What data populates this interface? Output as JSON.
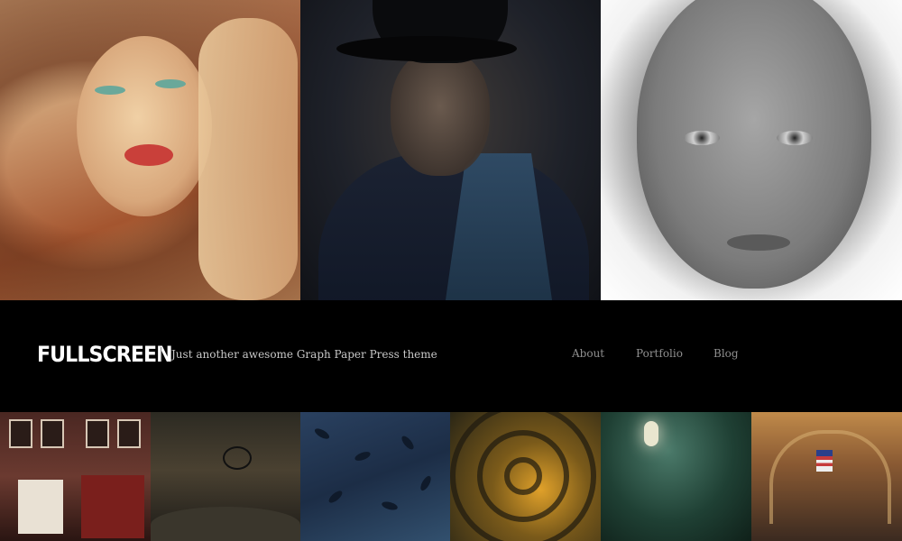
{
  "site": {
    "logo_text": "FULLSCREEN",
    "tagline": "Just another awesome Graph Paper Press theme"
  },
  "nav": {
    "items": [
      {
        "label": "About"
      },
      {
        "label": "Portfolio"
      },
      {
        "label": "Blog"
      }
    ]
  },
  "gallery": {
    "top_images": [
      {
        "name": "portrait-redhead"
      },
      {
        "name": "portrait-man-hat"
      },
      {
        "name": "portrait-freckled-woman"
      }
    ],
    "bottom_images": [
      {
        "name": "street-buildings"
      },
      {
        "name": "bmx-rider"
      },
      {
        "name": "blue-texture"
      },
      {
        "name": "yellow-tunnel"
      },
      {
        "name": "green-room-lightbulb"
      },
      {
        "name": "grand-central-terminal"
      }
    ]
  },
  "colors": {
    "background": "#000000",
    "logo": "#ffffff",
    "tagline": "#c8c8c8",
    "nav": "#8f8f8f"
  }
}
